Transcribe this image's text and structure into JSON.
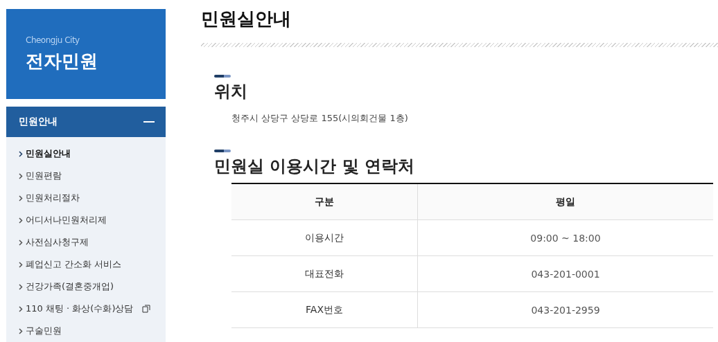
{
  "logo": {
    "subtitle": "Cheongju City",
    "title": "전자민원"
  },
  "sidebar": {
    "heading": "민원안내",
    "expanded": true,
    "items": [
      {
        "label": "민원실안내",
        "selected": true,
        "external": false
      },
      {
        "label": "민원편람",
        "selected": false,
        "external": false
      },
      {
        "label": "민원처리절차",
        "selected": false,
        "external": false
      },
      {
        "label": "어디서나민원처리제",
        "selected": false,
        "external": false
      },
      {
        "label": "사전심사청구제",
        "selected": false,
        "external": false
      },
      {
        "label": "폐업신고 간소화 서비스",
        "selected": false,
        "external": false
      },
      {
        "label": "건강가족(결혼중개업)",
        "selected": false,
        "external": false
      },
      {
        "label": "110 채팅 · 화상(수화)상담",
        "selected": false,
        "external": true
      },
      {
        "label": "구술민원",
        "selected": false,
        "external": false
      }
    ]
  },
  "page_title": "민원실안내",
  "sections": [
    {
      "kind": "text",
      "heading": "위치",
      "text": "청주시 상당구 상당로 155(시의회건물 1층)"
    },
    {
      "kind": "table",
      "heading": "민원실 이용시간 및 연락처",
      "columns": [
        "구분",
        "평일"
      ],
      "rows": [
        [
          "이용시간",
          "09:00 ~ 18:00"
        ],
        [
          "대표전화",
          "043-201-0001"
        ],
        [
          "FAX번호",
          "043-201-2959"
        ]
      ]
    }
  ]
}
